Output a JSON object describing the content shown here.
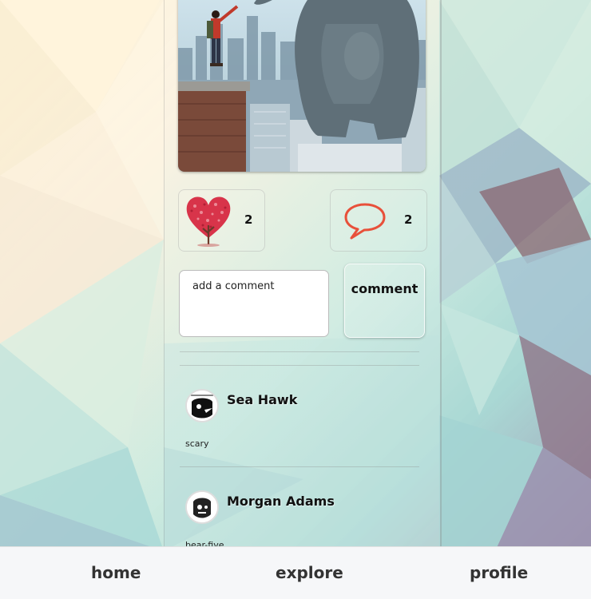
{
  "post": {
    "like_count": "2",
    "comment_count": "2"
  },
  "comment_form": {
    "placeholder": "add a comment",
    "submit_label": "comment"
  },
  "comments": [
    {
      "author": "Sea Hawk",
      "text": "scary"
    },
    {
      "author": "Morgan Adams",
      "text": "bear-five"
    }
  ],
  "nav": {
    "home": "home",
    "explore": "explore",
    "profile": "profile"
  },
  "colors": {
    "like_heart": "#d8344a",
    "comment_bubble": "#e8503a",
    "nav_bg": "#f6f7f9",
    "input_bg": "#ffffff"
  },
  "icons": {
    "like": "heart-tree-icon",
    "comment": "speech-bubble-icon"
  }
}
